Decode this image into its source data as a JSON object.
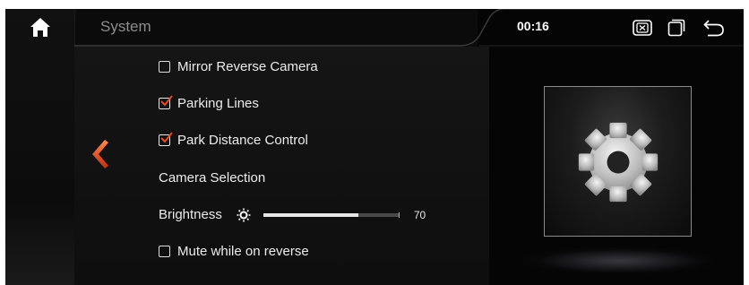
{
  "app": {
    "title": "System"
  },
  "status_bar": {
    "clock": "00:16",
    "icons": [
      "close-box-icon",
      "window-icon",
      "back-return-icon"
    ]
  },
  "nav": {
    "home_icon": "home-icon",
    "back_icon": "chevron-left-icon"
  },
  "settings": {
    "mirror_reverse_camera": {
      "label": "Mirror Reverse Camera",
      "checked": false
    },
    "parking_lines": {
      "label": "Parking Lines",
      "checked": true
    },
    "park_distance_control": {
      "label": "Park Distance Control",
      "checked": true
    },
    "camera_selection": {
      "label": "Camera Selection"
    },
    "brightness": {
      "label": "Brightness",
      "value": "70",
      "max": 100
    },
    "mute_while_on_reverse": {
      "label": "Mute while on reverse",
      "checked": false
    }
  },
  "preview": {
    "icon": "gear-icon"
  },
  "colors": {
    "accent": "#e8491f",
    "background": "#0b0b0b",
    "text": "#ececec",
    "title": "#8d8d8d"
  }
}
